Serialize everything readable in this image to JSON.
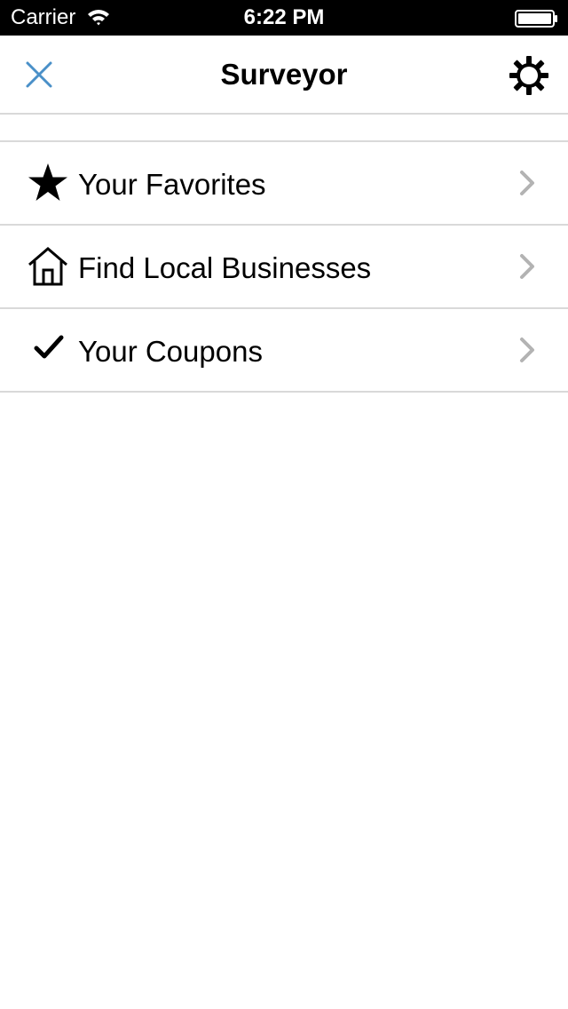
{
  "status_bar": {
    "carrier": "Carrier",
    "time": "6:22 PM",
    "wifi_icon": "wifi-icon",
    "battery_icon": "battery-full-icon"
  },
  "nav": {
    "title": "Surveyor",
    "close_icon": "close-icon",
    "settings_icon": "gear-icon",
    "close_color": "#4a90c8"
  },
  "menu": {
    "items": [
      {
        "label": "Your Favorites",
        "icon": "star-icon"
      },
      {
        "label": "Find Local Businesses",
        "icon": "house-icon"
      },
      {
        "label": "Your Coupons",
        "icon": "checkmark-icon"
      }
    ],
    "chevron_color": "#b3b3b3",
    "divider_color": "#d9d9d9"
  }
}
